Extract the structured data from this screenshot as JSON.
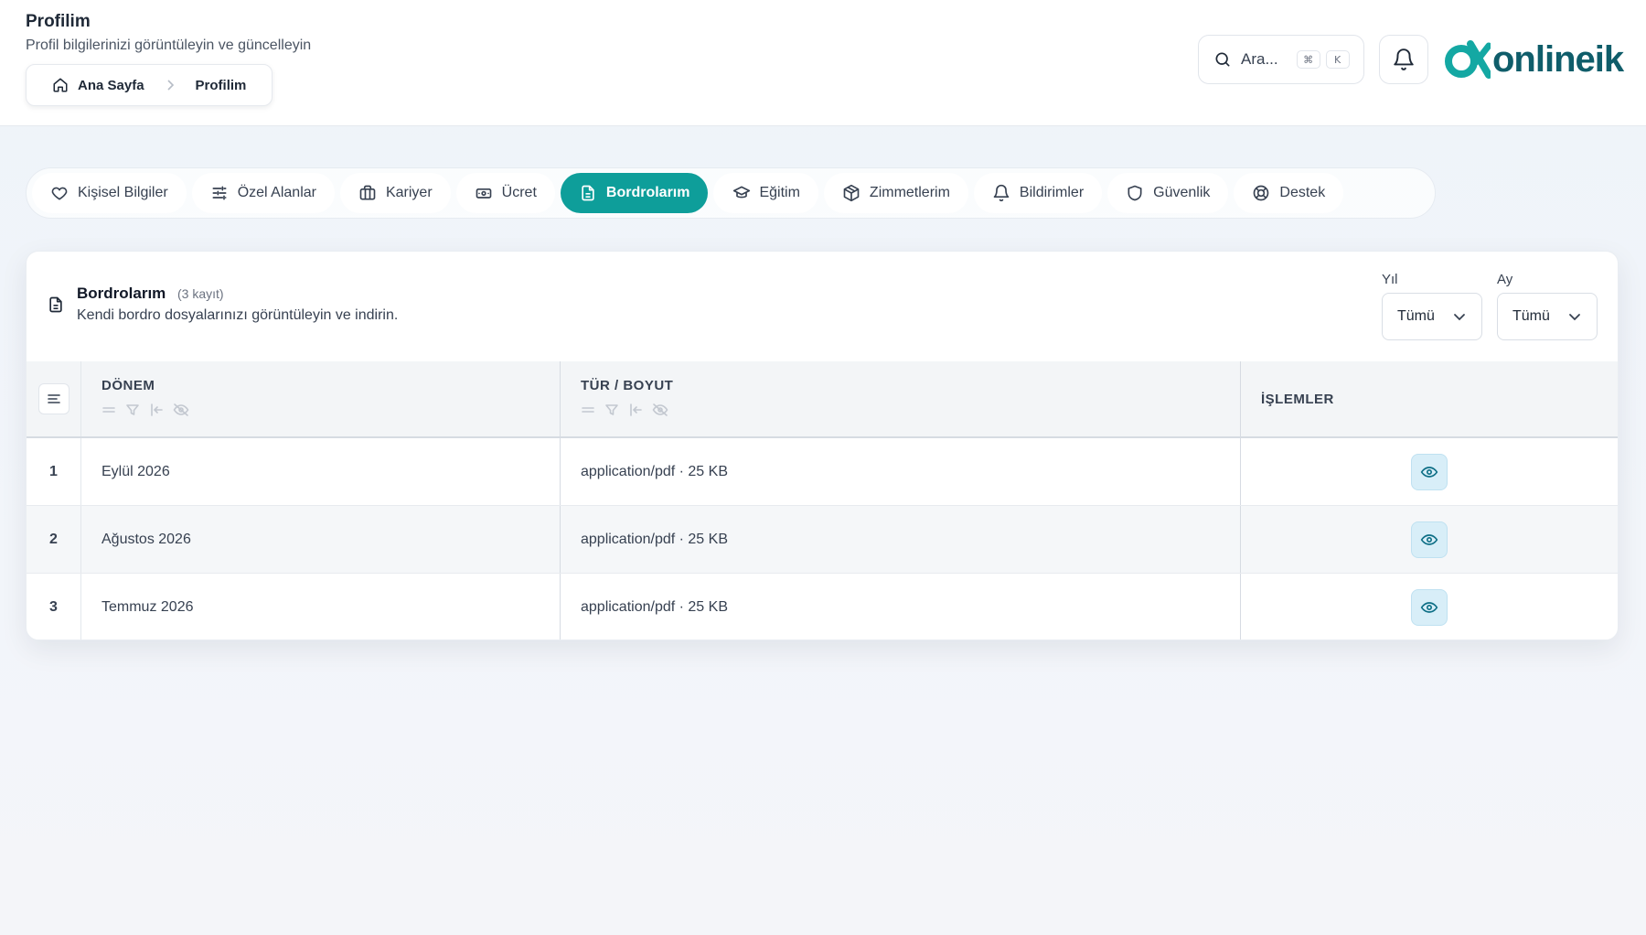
{
  "header": {
    "title": "Profilim",
    "subtitle": "Profil bilgilerinizi görüntüleyin ve güncelleyin",
    "breadcrumb": [
      "Ana Sayfa",
      "Profilim"
    ],
    "search_placeholder": "Ara...",
    "kbd": [
      "⌘",
      "K"
    ],
    "logo_text": "onlineik"
  },
  "tabs": [
    {
      "label": "Kişisel Bilgiler",
      "icon": "heart-icon",
      "active": false
    },
    {
      "label": "Özel Alanlar",
      "icon": "sliders-icon",
      "active": false
    },
    {
      "label": "Kariyer",
      "icon": "briefcase-icon",
      "active": false
    },
    {
      "label": "Ücret",
      "icon": "money-icon",
      "active": false
    },
    {
      "label": "Bordrolarım",
      "icon": "document-icon",
      "active": true
    },
    {
      "label": "Eğitim",
      "icon": "graduation-cap-icon",
      "active": false
    },
    {
      "label": "Zimmetlerim",
      "icon": "box-icon",
      "active": false
    },
    {
      "label": "Bildirimler",
      "icon": "bell-icon",
      "active": false
    },
    {
      "label": "Güvenlik",
      "icon": "shield-icon",
      "active": false
    },
    {
      "label": "Destek",
      "icon": "lifebuoy-icon",
      "active": false
    }
  ],
  "payroll": {
    "title": "Bordrolarım",
    "count": "(3 kayıt)",
    "description": "Kendi bordro dosyalarınızı görüntüleyin ve indirin.",
    "filters": {
      "year": {
        "label": "Yıl",
        "value": "Tümü"
      },
      "month": {
        "label": "Ay",
        "value": "Tümü"
      }
    },
    "columns": [
      "DÖNEM",
      "TÜR / BOYUT",
      "İŞLEMLER"
    ],
    "rows": [
      {
        "index": "1",
        "period": "Eylül 2026",
        "type": "application/pdf · 25 KB"
      },
      {
        "index": "2",
        "period": "Ağustos 2026",
        "type": "application/pdf · 25 KB"
      },
      {
        "index": "3",
        "period": "Temmuz 2026",
        "type": "application/pdf · 25 KB"
      }
    ]
  },
  "colors": {
    "accent": "#0e9e9a",
    "logo": "#0f5d6a",
    "logo_mark": "#14a8a3",
    "view_button": "#d8eef8"
  }
}
